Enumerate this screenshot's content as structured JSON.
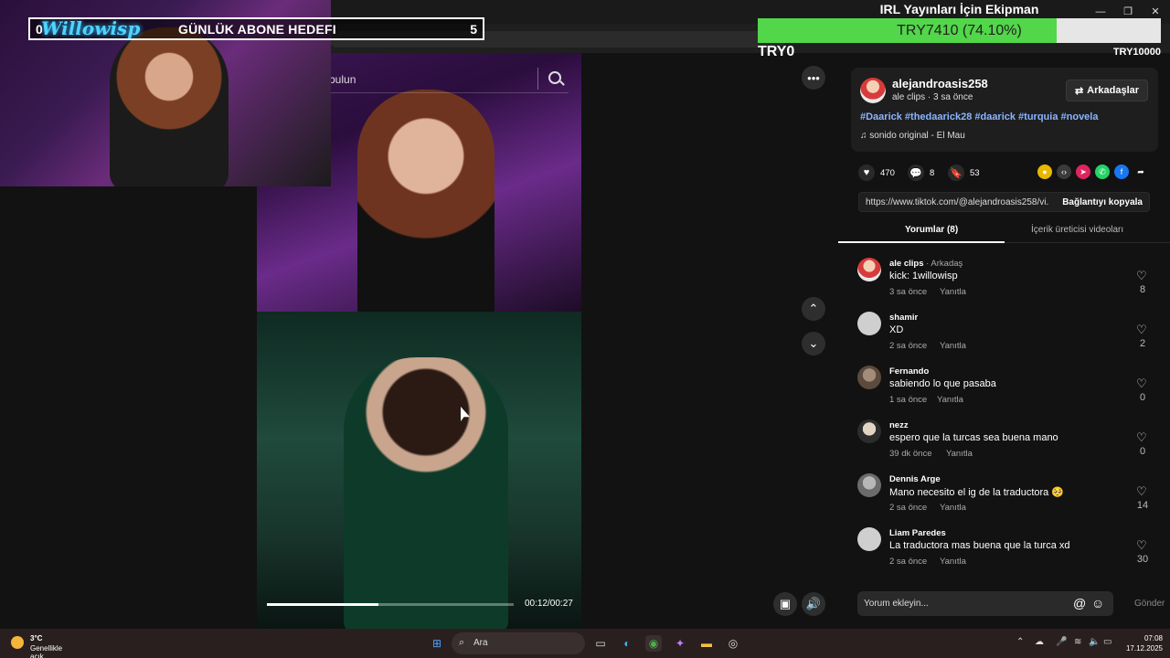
{
  "window": {
    "minimize": "—",
    "restore": "❐",
    "close": "✕"
  },
  "overlay": {
    "logo_text": "Willowisp",
    "goal_title": "GÜNLÜK ABONE HEDEFI",
    "goal_current": "0",
    "goal_target": "5"
  },
  "donation_goal": {
    "title": "IRL Yayınları İçin Ekipman",
    "amount_text": "TRY7410 (74.10%)",
    "progress_fraction": 0.741,
    "min_label": "TRY0",
    "max_label": "TRY10000"
  },
  "video": {
    "search_placeholder": "bulun",
    "progress_fraction": 0.45,
    "timecode": "00:12/00:27"
  },
  "post": {
    "author": "alejandroasis258",
    "author_meta": "ale clips · 3 sa önce",
    "friends_button": "Arkadaşlar",
    "hashtags": "#Daarick #thedaarick28 #daarick #turquia #novela",
    "music": "sonido original - El Mau",
    "likes": "470",
    "comments": "8",
    "saves": "53",
    "link": "https://www.tiktok.com/@alejandroasis258/vi...",
    "copy_button": "Bağlantıyı kopyala"
  },
  "tabs": {
    "comments": "Yorumlar (8)",
    "creator_videos": "İçerik üreticisi videoları"
  },
  "comments": [
    {
      "name": "ale clips",
      "badge": " · Arkadaş",
      "text": "kick: 1willowisp",
      "time": "3 sa önce",
      "reply": "Yanıtla",
      "likes": "8"
    },
    {
      "name": "shamir",
      "badge": "",
      "text": "XD",
      "time": "2 sa önce",
      "reply": "Yanıtla",
      "likes": "2"
    },
    {
      "name": "Fernando",
      "badge": "",
      "text": "sabiendo lo que pasaba",
      "time": "1 sa önce",
      "reply": "Yanıtla",
      "likes": "0"
    },
    {
      "name": "nezz",
      "badge": "",
      "text": "espero que la turcas sea buena mano",
      "time": "39 dk önce",
      "reply": "Yanıtla",
      "likes": "0"
    },
    {
      "name": "Dennis Arge",
      "badge": "",
      "text": "Mano necesito el ig de la traductora 🥺",
      "time": "2 sa önce",
      "reply": "Yanıtla",
      "likes": "14"
    },
    {
      "name": "Liam Paredes",
      "badge": "",
      "text": "La traductora mas buena que la turca xd",
      "time": "2 sa önce",
      "reply": "Yanıtla",
      "likes": "30"
    }
  ],
  "compose": {
    "placeholder": "Yorum ekleyin...",
    "send": "Gönder"
  },
  "taskbar": {
    "weather_temp": "3°C",
    "weather_desc": "Genellikle açık",
    "search_label": "Ara",
    "time": "07:08",
    "date": "17.12.2025"
  }
}
